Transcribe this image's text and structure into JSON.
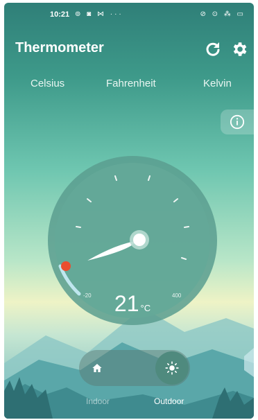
{
  "status": {
    "time": "10:21",
    "left_icons": "⊚ ◙ ⋈ ···",
    "right_icons": "⊘ ⊙ ⁂ ▭"
  },
  "app": {
    "title": "Thermometer"
  },
  "tabs": [
    {
      "label": "Celsius"
    },
    {
      "label": "Fahrenheit"
    },
    {
      "label": "Kelvin"
    }
  ],
  "gauge": {
    "value": "21",
    "unit": "°C",
    "min_label": "-20",
    "max_label": "400"
  },
  "modes": {
    "indoor": "Indoor",
    "outdoor": "Outdoor",
    "selected": "outdoor"
  },
  "colors": {
    "accent": "#e94e2f",
    "dial": "#5a9d8f"
  }
}
